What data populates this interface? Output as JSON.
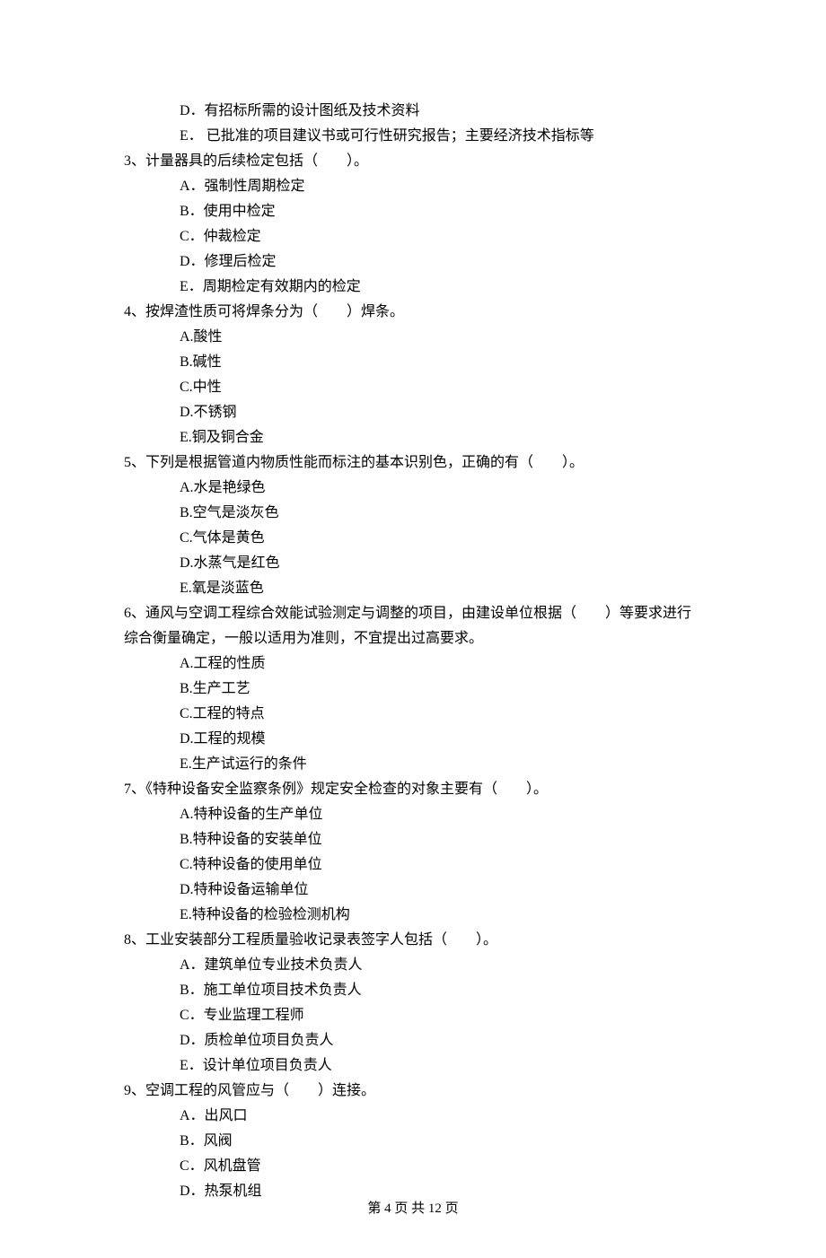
{
  "prev_options": {
    "D": "D．有招标所需的设计图纸及技术资料",
    "E": "E． 已批准的项目建议书或可行性研究报告；主要经济技术指标等"
  },
  "questions": [
    {
      "stem": "3、计量器具的后续检定包括（　　）。",
      "options": [
        "A．强制性周期检定",
        "B．使用中检定",
        "C．仲裁检定",
        "D．修理后检定",
        "E．周期检定有效期内的检定"
      ]
    },
    {
      "stem": "4、按焊渣性质可将焊条分为（　　）焊条。",
      "options": [
        "A.酸性",
        "B.碱性",
        "C.中性",
        "D.不锈钢",
        "E.铜及铜合金"
      ]
    },
    {
      "stem": "5、下列是根据管道内物质性能而标注的基本识别色，正确的有（　　）。",
      "options": [
        "A.水是艳绿色",
        "B.空气是淡灰色",
        "C.气体是黄色",
        "D.水蒸气是红色",
        "E.氧是淡蓝色"
      ]
    },
    {
      "stem": "6、通风与空调工程综合效能试验测定与调整的项目，由建设单位根据（　　）等要求进行",
      "stem_cont": "综合衡量确定，一般以适用为准则，不宜提出过高要求。",
      "options": [
        "A.工程的性质",
        "B.生产工艺",
        "C.工程的特点",
        "D.工程的规模",
        "E.生产试运行的条件"
      ]
    },
    {
      "stem": "7、《特种设备安全监察条例》规定安全检查的对象主要有（　　）。",
      "options": [
        "A.特种设备的生产单位",
        "B.特种设备的安装单位",
        "C.特种设备的使用单位",
        "D.特种设备运输单位",
        "E.特种设备的检验检测机构"
      ]
    },
    {
      "stem": "8、工业安装部分工程质量验收记录表签字人包括（　　）。",
      "options": [
        "A．建筑单位专业技术负责人",
        "B．施工单位项目技术负责人",
        "C．专业监理工程师",
        "D．质检单位项目负责人",
        "E．设计单位项目负责人"
      ]
    },
    {
      "stem": "9、空调工程的风管应与（　　）连接。",
      "options": [
        "A．出风口",
        "B．风阀",
        "C．风机盘管",
        "D．热泵机组"
      ]
    }
  ],
  "footer": "第 4 页 共 12 页"
}
